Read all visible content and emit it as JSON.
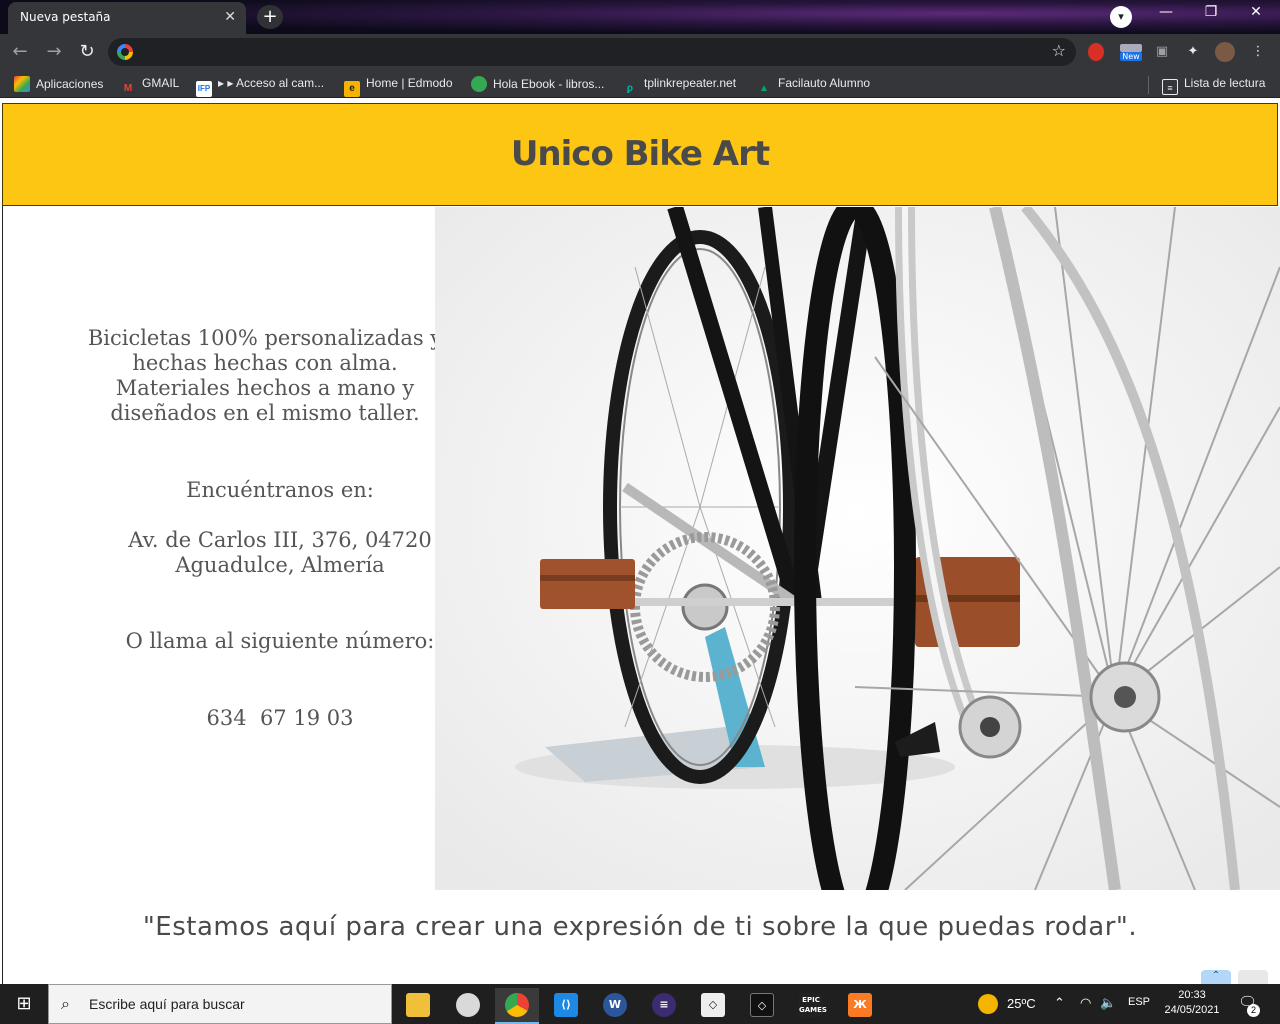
{
  "browser": {
    "tab_title": "Nueva pestaña",
    "tab_close": "✕",
    "new_tab": "+",
    "address": "",
    "window_controls": [
      "—",
      "❐",
      "✕"
    ]
  },
  "toolbar": {
    "back": "←",
    "forward": "→",
    "reload": "↻",
    "bookmark_star": "☆",
    "new_badge": "New",
    "menu": "⋮"
  },
  "bookmarks": {
    "items": [
      {
        "label": "Aplicaciones",
        "icon": "apps-grid-icon",
        "color": "#ea4335"
      },
      {
        "label": "GMAIL",
        "icon": "gmail-icon",
        "color": "#ea4335"
      },
      {
        "label": "▸ ▸ Acceso al cam...",
        "icon": "ifp-icon",
        "color": "#1a73e8"
      },
      {
        "label": "Home | Edmodo",
        "icon": "edmodo-icon",
        "color": "#f6b400"
      },
      {
        "label": "Hola Ebook - libros...",
        "icon": "ebook-icon",
        "color": "#34a853"
      },
      {
        "label": "tplinkrepeater.net",
        "icon": "tplink-icon",
        "color": "#00b3a4"
      },
      {
        "label": "Facilauto Alumno",
        "icon": "facilauto-icon",
        "color": "#00a86b"
      }
    ],
    "reading_list": "Lista de lectura"
  },
  "page": {
    "site_title": "Unico Bike Art",
    "intro_lines": [
      "Bicicletas 100% personalizadas y",
      "hechas hechas con alma.",
      "Materiales hechos a mano y",
      "diseñados en el mismo taller."
    ],
    "find_us": "Encuéntranos en:",
    "address_lines": [
      "Av. de Carlos III, 376, 04720",
      "Aguadulce, Almería"
    ],
    "call_us": "O llama al siguiente número:",
    "phone": "634  67 19 03",
    "quote": "\"Estamos aquí para crear una expresión de ti sobre la que puedas rodar\".",
    "colors": {
      "header_bg": "#fdc612",
      "text": "#555555"
    }
  },
  "taskbar": {
    "search_placeholder": "Escribe aquí para buscar",
    "weather": "25ºC",
    "language": "ESP",
    "time": "20:33",
    "date": "24/05/2021",
    "notifications": "2"
  }
}
